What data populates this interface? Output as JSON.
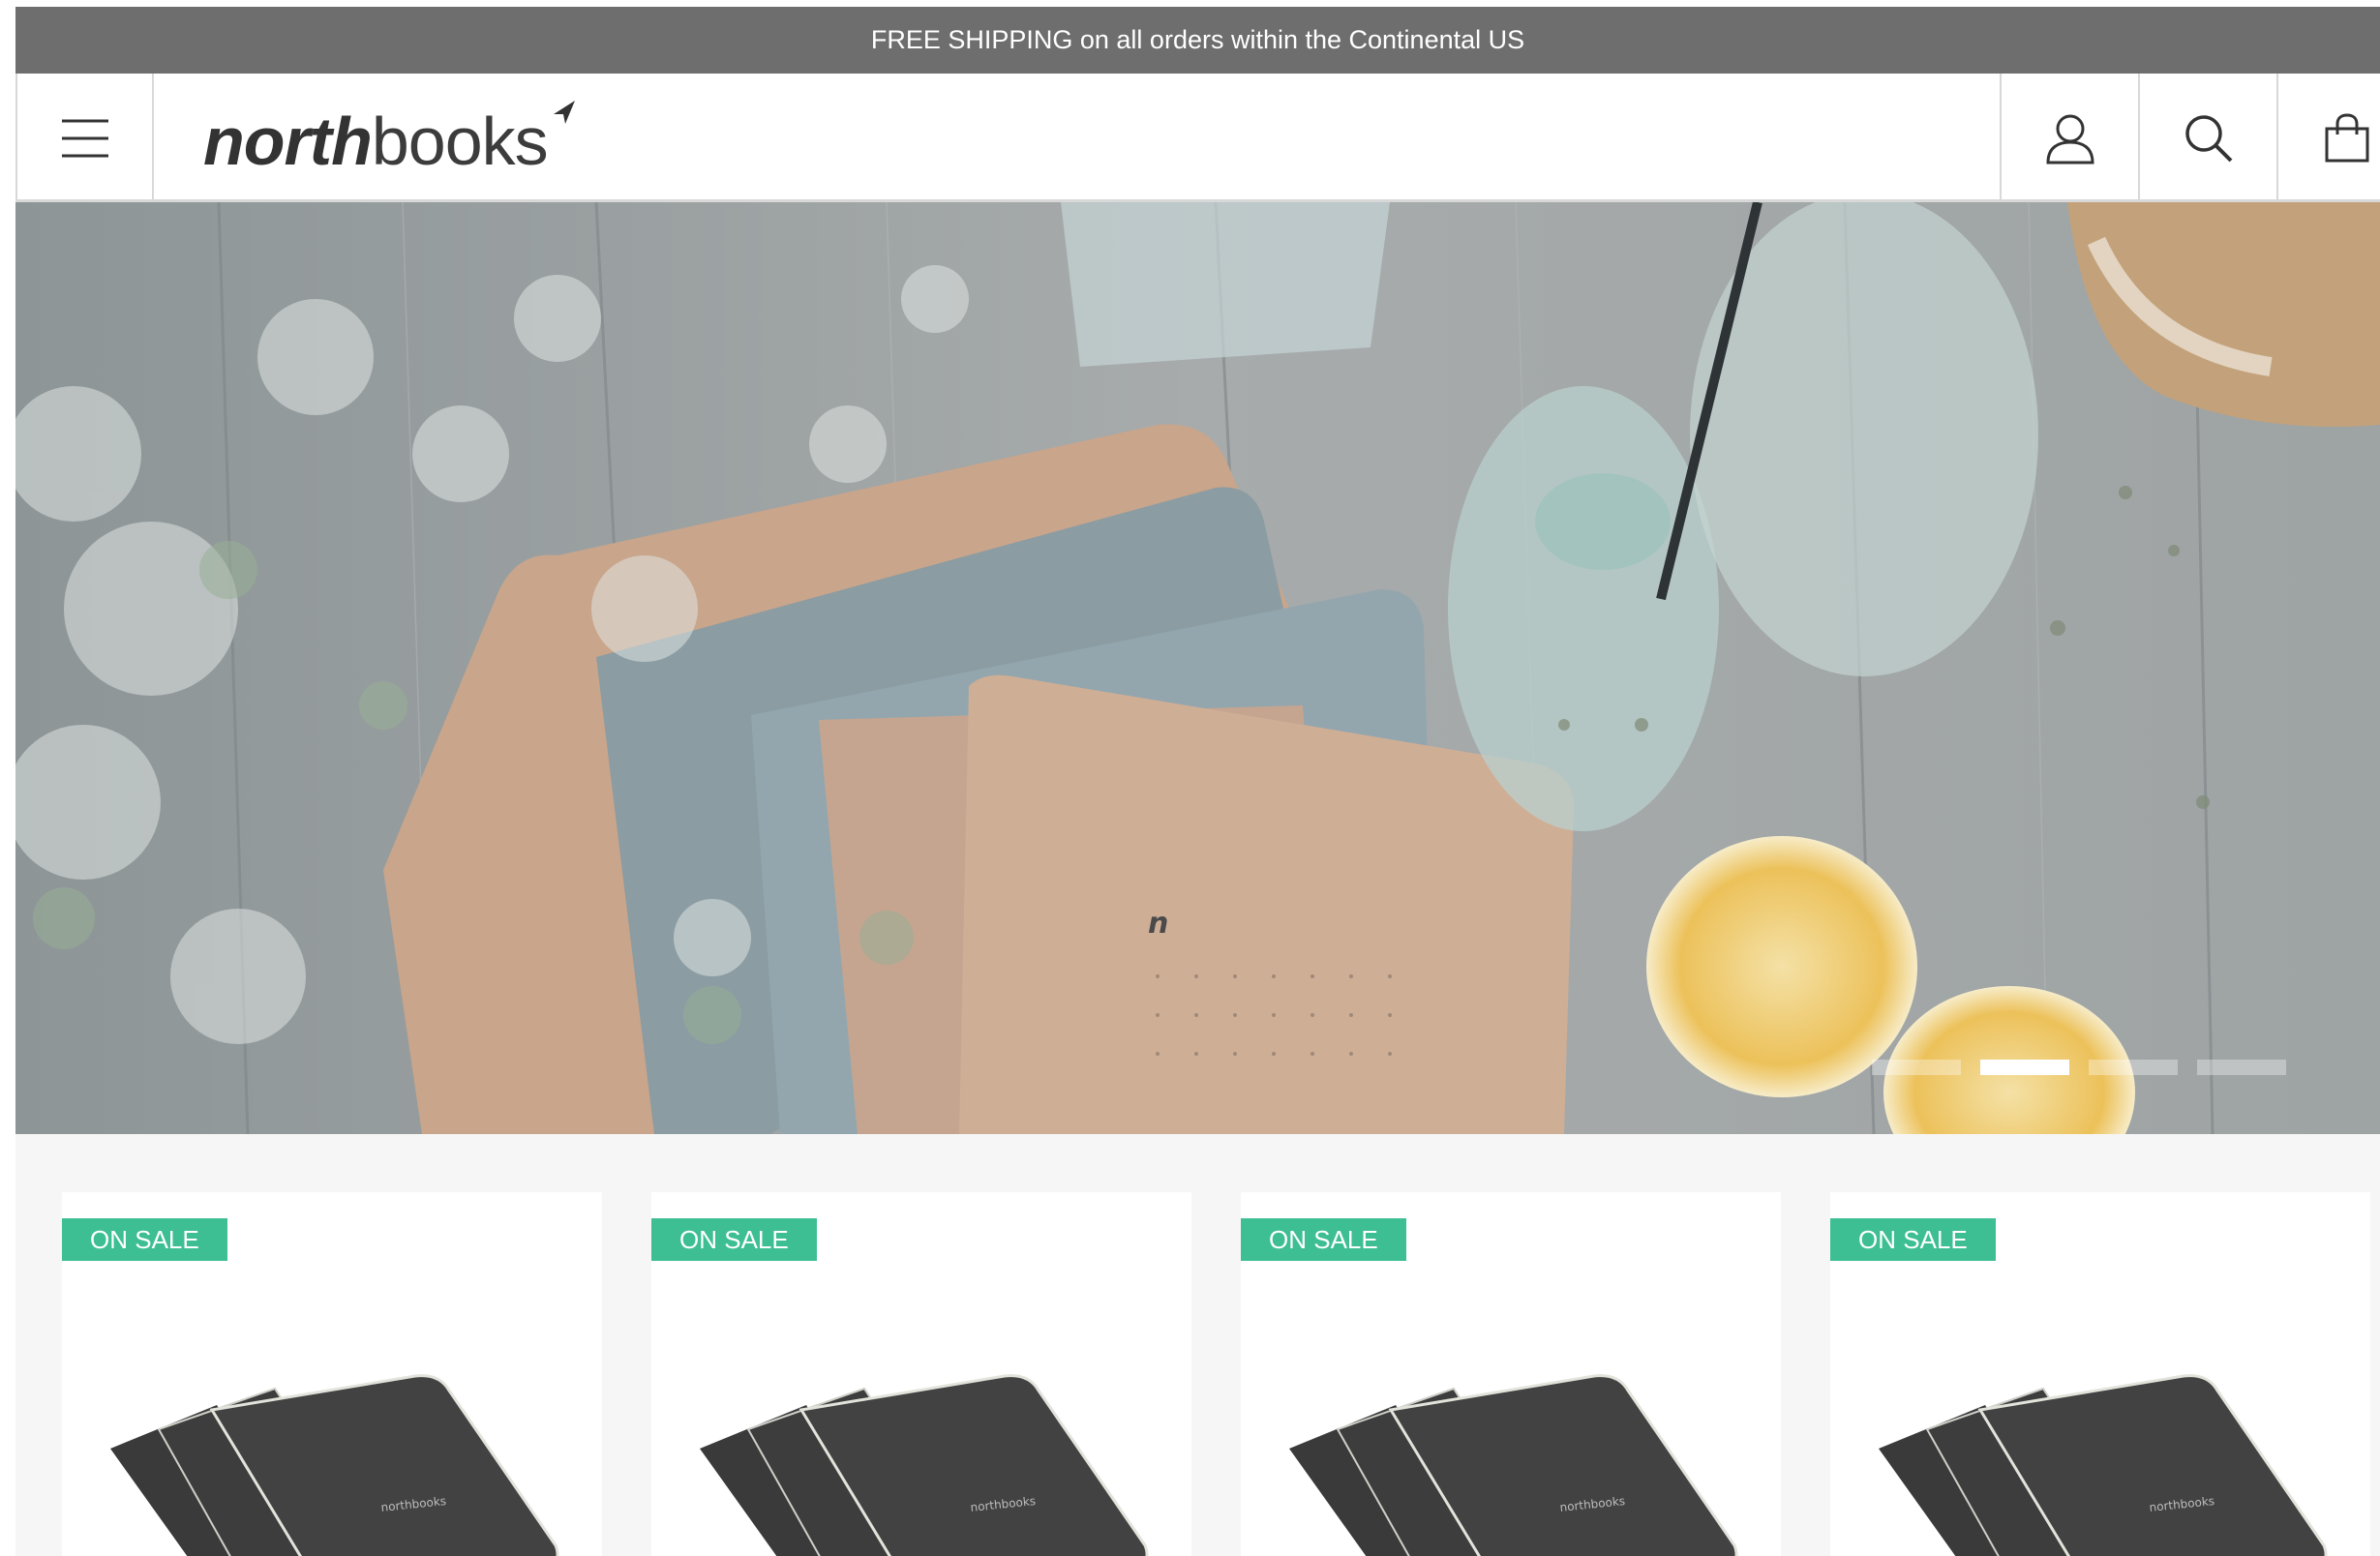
{
  "announcement": "FREE SHIPPING on all orders within the Continental US",
  "header": {
    "logo_bold": "north",
    "logo_light": "books",
    "icons": [
      "menu-icon",
      "account-icon",
      "search-icon",
      "cart-icon"
    ]
  },
  "hero": {
    "slides_total": 4,
    "active_slide": 2
  },
  "products": [
    {
      "badge": "ON SALE"
    },
    {
      "badge": "ON SALE"
    },
    {
      "badge": "ON SALE"
    },
    {
      "badge": "ON SALE"
    }
  ],
  "colors": {
    "announcement_bg": "#6e6e6e",
    "sale_badge": "#3dbf93",
    "text_dark": "#333333"
  }
}
